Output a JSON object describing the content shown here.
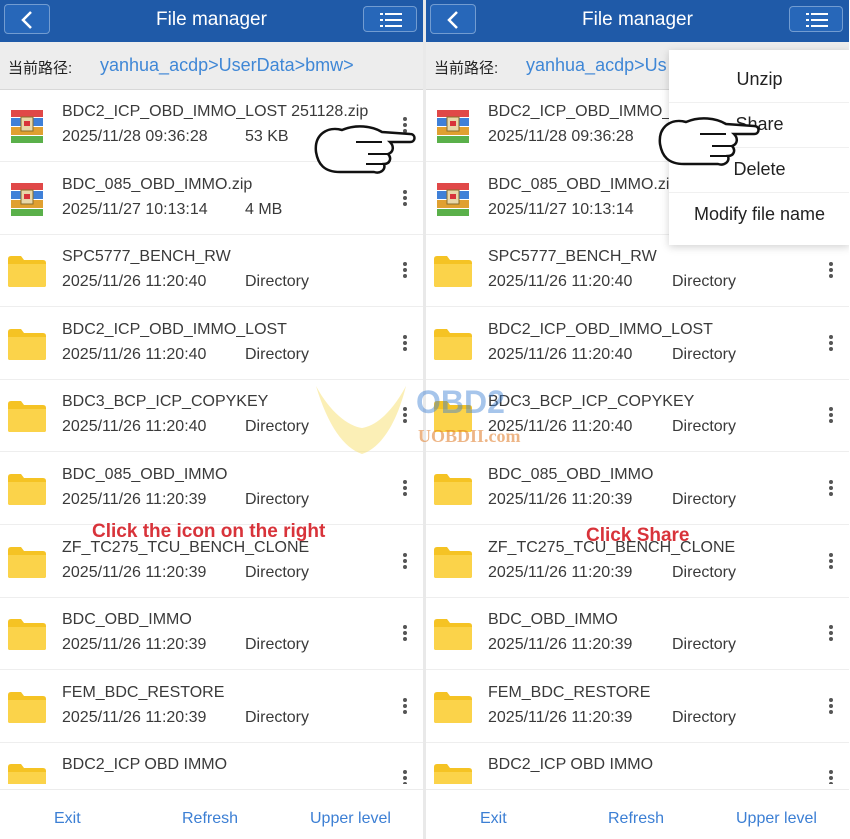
{
  "left": {
    "title": "File manager",
    "path_label": "当前路径:",
    "path_value": "yanhua_acdp>UserData>bmw>",
    "files": [
      {
        "name": "BDC2_ICP_OBD_IMMO_LOST 251128.zip",
        "date": "2025/11/28 09:36:28",
        "size": "53 KB",
        "icon": "zip-archive-icon"
      },
      {
        "name": "BDC_085_OBD_IMMO.zip",
        "date": "2025/11/27 10:13:14",
        "size": "4 MB",
        "icon": "zip-archive-icon"
      },
      {
        "name": "SPC5777_BENCH_RW",
        "date": "2025/11/26 11:20:40",
        "size": "Directory",
        "icon": "folder-icon"
      },
      {
        "name": "BDC2_ICP_OBD_IMMO_LOST",
        "date": "2025/11/26 11:20:40",
        "size": "Directory",
        "icon": "folder-icon"
      },
      {
        "name": "BDC3_BCP_ICP_COPYKEY",
        "date": "2025/11/26 11:20:40",
        "size": "Directory",
        "icon": "folder-icon"
      },
      {
        "name": "BDC_085_OBD_IMMO",
        "date": "2025/11/26 11:20:39",
        "size": "Directory",
        "icon": "folder-icon"
      },
      {
        "name": "ZF_TC275_TCU_BENCH_CLONE",
        "date": "2025/11/26 11:20:39",
        "size": "Directory",
        "icon": "folder-icon"
      },
      {
        "name": "BDC_OBD_IMMO",
        "date": "2025/11/26 11:20:39",
        "size": "Directory",
        "icon": "folder-icon"
      },
      {
        "name": "FEM_BDC_RESTORE",
        "date": "2025/11/26 11:20:39",
        "size": "Directory",
        "icon": "folder-icon"
      },
      {
        "name": "BDC2_ICP OBD IMMO",
        "date": "",
        "size": "",
        "icon": "folder-icon"
      }
    ],
    "hint": "Click the icon on the right",
    "bottom": {
      "exit": "Exit",
      "refresh": "Refresh",
      "upper": "Upper level"
    }
  },
  "right": {
    "title": "File manager",
    "path_label": "当前路径:",
    "path_value": "yanhua_acdp>Us",
    "files": [
      {
        "name": "BDC2_ICP_OBD_IMMO_L",
        "date": "2025/11/28 09:36:28",
        "size": "",
        "icon": "zip-archive-icon"
      },
      {
        "name": "BDC_085_OBD_IMMO.zi",
        "date": "2025/11/27 10:13:14",
        "size": "",
        "icon": "zip-archive-icon"
      },
      {
        "name": "SPC5777_BENCH_RW",
        "date": "2025/11/26 11:20:40",
        "size": "Directory",
        "icon": "folder-icon"
      },
      {
        "name": "BDC2_ICP_OBD_IMMO_LOST",
        "date": "2025/11/26 11:20:40",
        "size": "Directory",
        "icon": "folder-icon"
      },
      {
        "name": "BDC3_BCP_ICP_COPYKEY",
        "date": "2025/11/26 11:20:40",
        "size": "Directory",
        "icon": "folder-icon"
      },
      {
        "name": "BDC_085_OBD_IMMO",
        "date": "2025/11/26 11:20:39",
        "size": "Directory",
        "icon": "folder-icon"
      },
      {
        "name": "ZF_TC275_TCU_BENCH_CLONE",
        "date": "2025/11/26 11:20:39",
        "size": "Directory",
        "icon": "folder-icon"
      },
      {
        "name": "BDC_OBD_IMMO",
        "date": "2025/11/26 11:20:39",
        "size": "Directory",
        "icon": "folder-icon"
      },
      {
        "name": "FEM_BDC_RESTORE",
        "date": "2025/11/26 11:20:39",
        "size": "Directory",
        "icon": "folder-icon"
      },
      {
        "name": "BDC2_ICP OBD IMMO",
        "date": "",
        "size": "",
        "icon": "folder-icon"
      }
    ],
    "popup": [
      "Unzip",
      "Share",
      "Delete",
      "Modify file name"
    ],
    "hint": "Click Share",
    "bottom": {
      "exit": "Exit",
      "refresh": "Refresh",
      "upper": "Upper level"
    }
  },
  "watermark": {
    "brand": "OBD2",
    "site": "UOBDII.com"
  },
  "colors": {
    "topbar": "#1f5aa8",
    "path_link": "#3f87d6",
    "hint": "#d8333a",
    "bottom_link": "#3c7fd4",
    "folder": "#f5c324"
  }
}
